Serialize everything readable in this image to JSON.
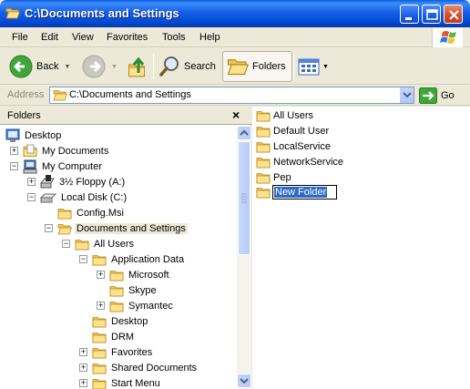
{
  "window": {
    "title": "C:\\Documents and Settings"
  },
  "menu": [
    "File",
    "Edit",
    "View",
    "Favorites",
    "Tools",
    "Help"
  ],
  "toolbar": {
    "back_label": "Back",
    "search_label": "Search",
    "folders_label": "Folders"
  },
  "address": {
    "label": "Address",
    "value": "C:\\Documents and Settings",
    "go_label": "Go"
  },
  "folders_pane": {
    "title": "Folders",
    "close_glyph": "×",
    "tree": [
      {
        "label": "Desktop"
      },
      {
        "label": "My Documents"
      },
      {
        "label": "My Computer"
      },
      {
        "label": "3½ Floppy (A:)"
      },
      {
        "label": "Local Disk (C:)"
      },
      {
        "label": "Config.Msi"
      },
      {
        "label": "Documents and Settings"
      },
      {
        "label": "All Users"
      },
      {
        "label": "Application Data"
      },
      {
        "label": "Microsoft"
      },
      {
        "label": "Skype"
      },
      {
        "label": "Symantec"
      },
      {
        "label": "Desktop"
      },
      {
        "label": "DRM"
      },
      {
        "label": "Favorites"
      },
      {
        "label": "Shared Documents"
      },
      {
        "label": "Start Menu"
      }
    ]
  },
  "contents": [
    "All Users",
    "Default User",
    "LocalService",
    "NetworkService",
    "Pep"
  ],
  "rename_value": "New Folder",
  "colors": {
    "titlebar": "#0A5FE0",
    "selection": "#316AC5",
    "folder": "#F3C74F"
  }
}
